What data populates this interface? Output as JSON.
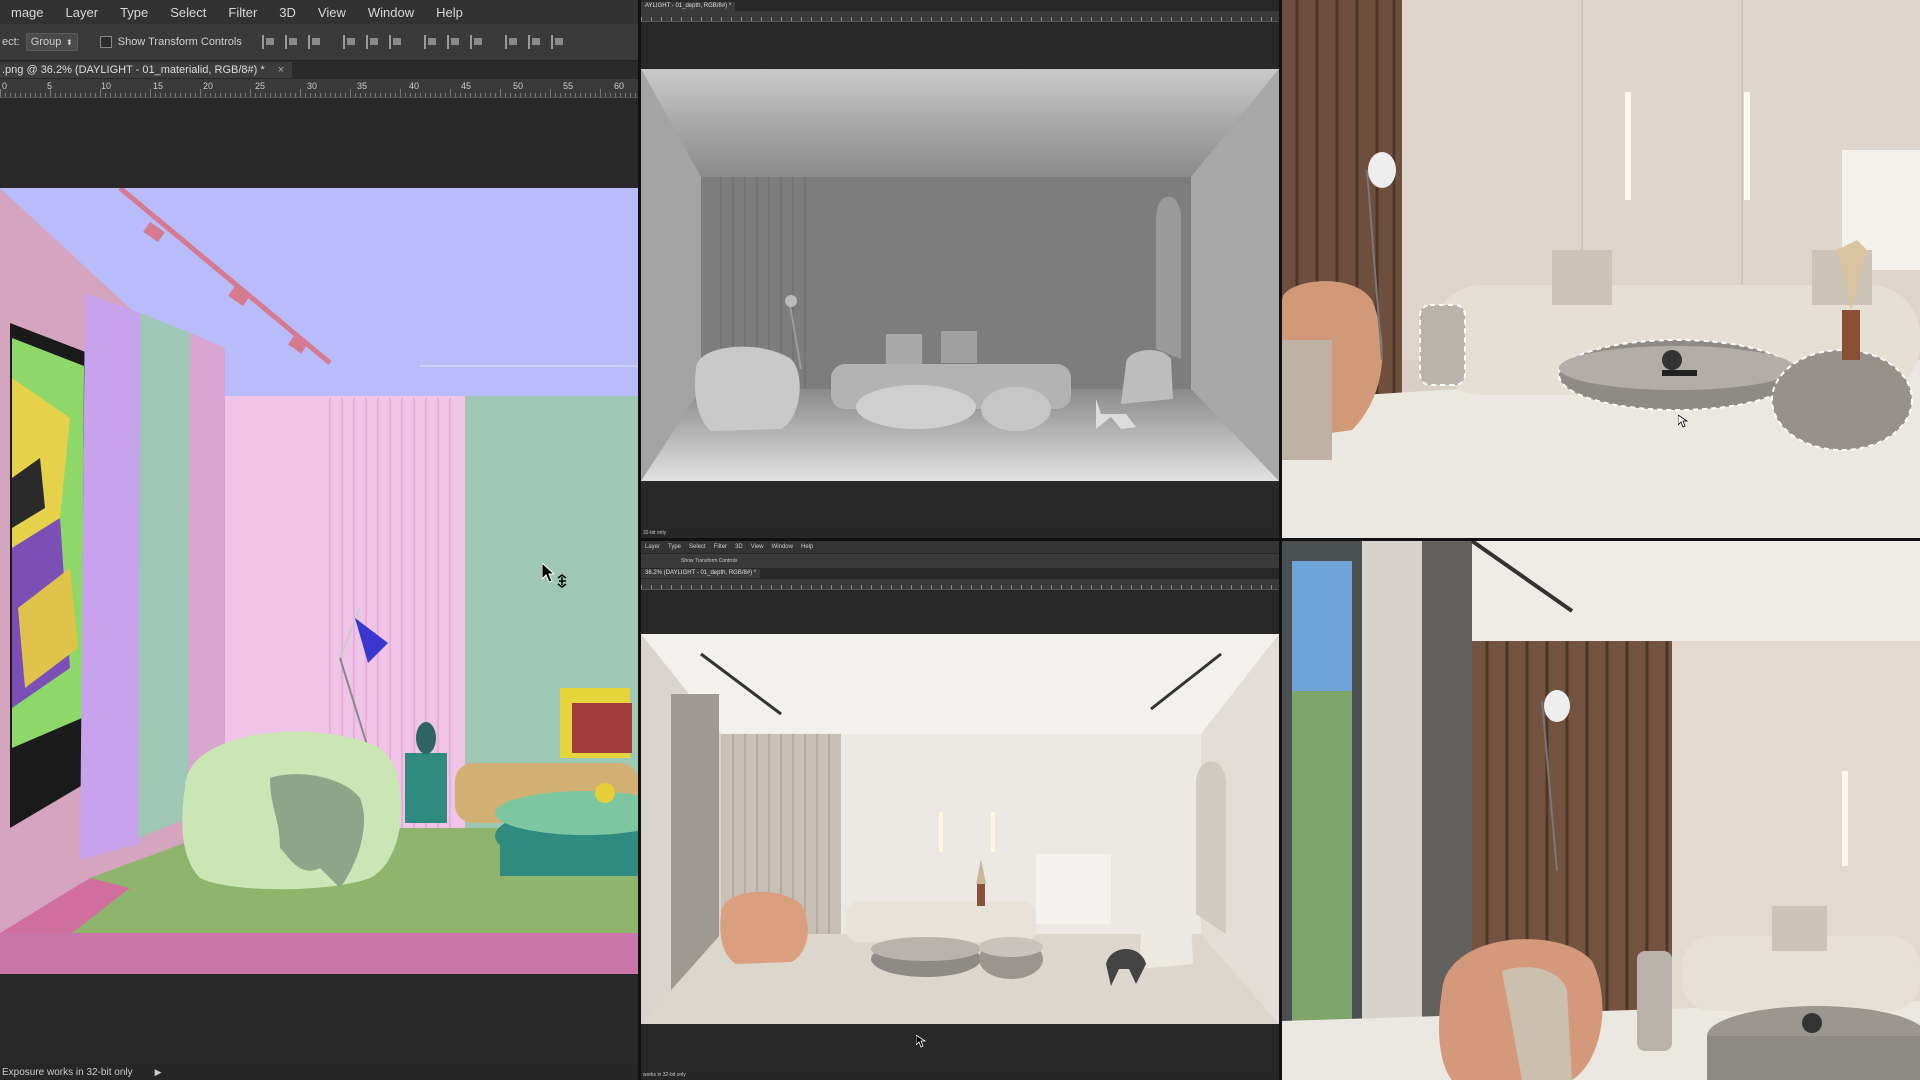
{
  "left_window": {
    "menu": [
      "mage",
      "Layer",
      "Type",
      "Select",
      "Filter",
      "3D",
      "View",
      "Window",
      "Help"
    ],
    "options": {
      "select_label": "ect:",
      "select_value": "Group",
      "transform_label": "Show Transform Controls"
    },
    "doc_tab": {
      "title": ".png @ 36.2% (DAYLIGHT - 01_materialid, RGB/8#) *",
      "close": "×"
    },
    "ruler_ticks": [
      "0",
      "5",
      "10",
      "15",
      "20",
      "25",
      "30",
      "35",
      "40",
      "45",
      "50",
      "55",
      "60"
    ],
    "status": "Exposure works in 32-bit only"
  },
  "mid_top_window": {
    "doc_tab": "AYLIGHT - 01_depth, RGB/8#) *",
    "status": "32-bit only"
  },
  "mid_bottom_window": {
    "menu": [
      "Layer",
      "Type",
      "Select",
      "Filter",
      "3D",
      "View",
      "Window",
      "Help"
    ],
    "transform_label": "Show Transform Controls",
    "doc_tab": "36.2% (DAYLIGHT - 01_depth, RGB/8#) *",
    "status": "works in 32-bit only"
  },
  "colors": {
    "ui_dark": "#282828",
    "menubar": "#323232",
    "materialid_ceiling": "#b8bcfa",
    "materialid_floor": "#8fb56c",
    "materialid_pink_wall": "#f0c4e6",
    "materialid_teal_wall": "#9ec7b6"
  }
}
